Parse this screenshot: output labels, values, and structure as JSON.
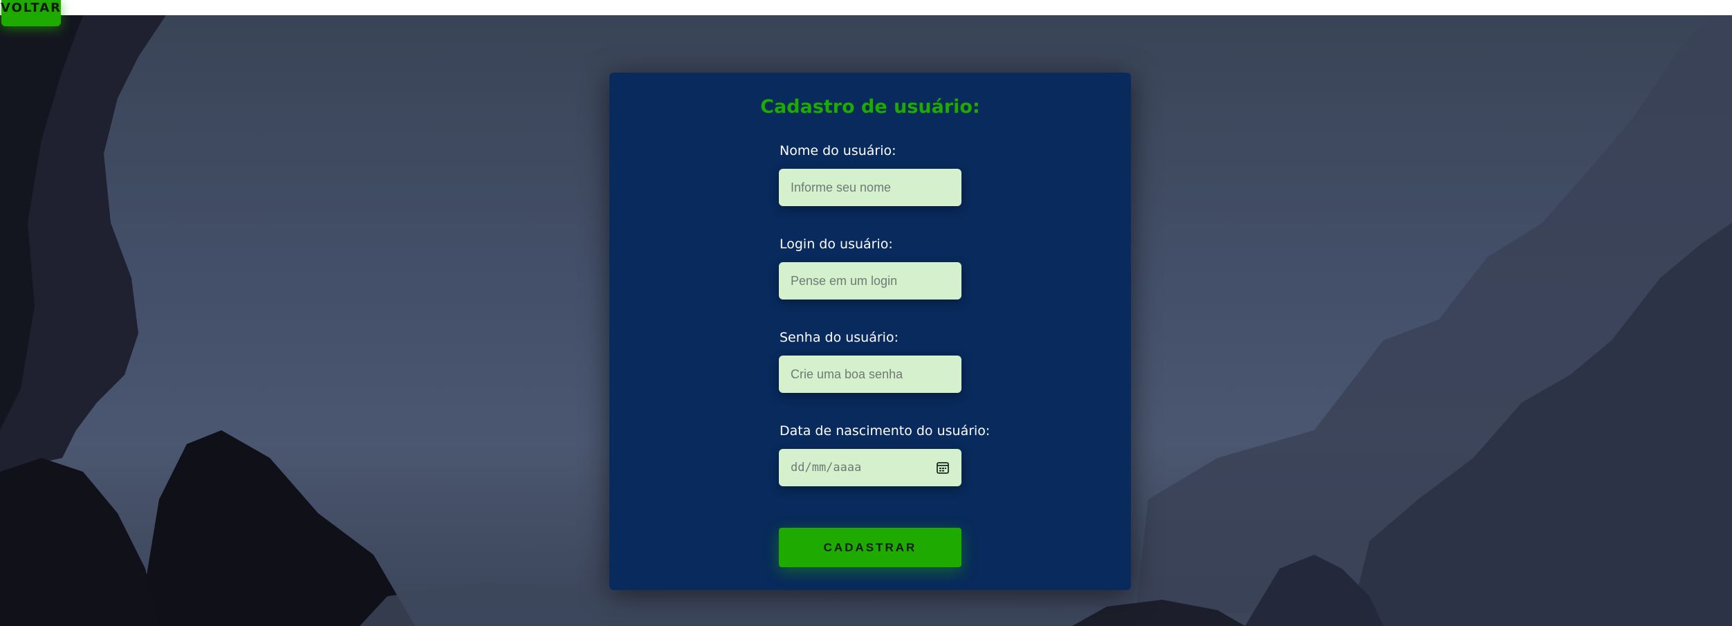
{
  "nav": {
    "back_label": "VOLTAR"
  },
  "form": {
    "title": "Cadastro de usuário:",
    "fields": [
      {
        "label": "Nome do usuário:",
        "placeholder": "Informe seu nome"
      },
      {
        "label": "Login do usuário:",
        "placeholder": "Pense em um login"
      },
      {
        "label": "Senha do usuário:",
        "placeholder": "Crie uma boa senha"
      },
      {
        "label": "Data de nascimento do usuário:",
        "placeholder": "dd/mm/aaaa",
        "icon": "calendar-icon"
      }
    ],
    "submit_label": "CADASTRAR"
  },
  "colors": {
    "accent": "#1faa00",
    "card": "#082a5c",
    "input_bg": "#d4f0cc"
  }
}
